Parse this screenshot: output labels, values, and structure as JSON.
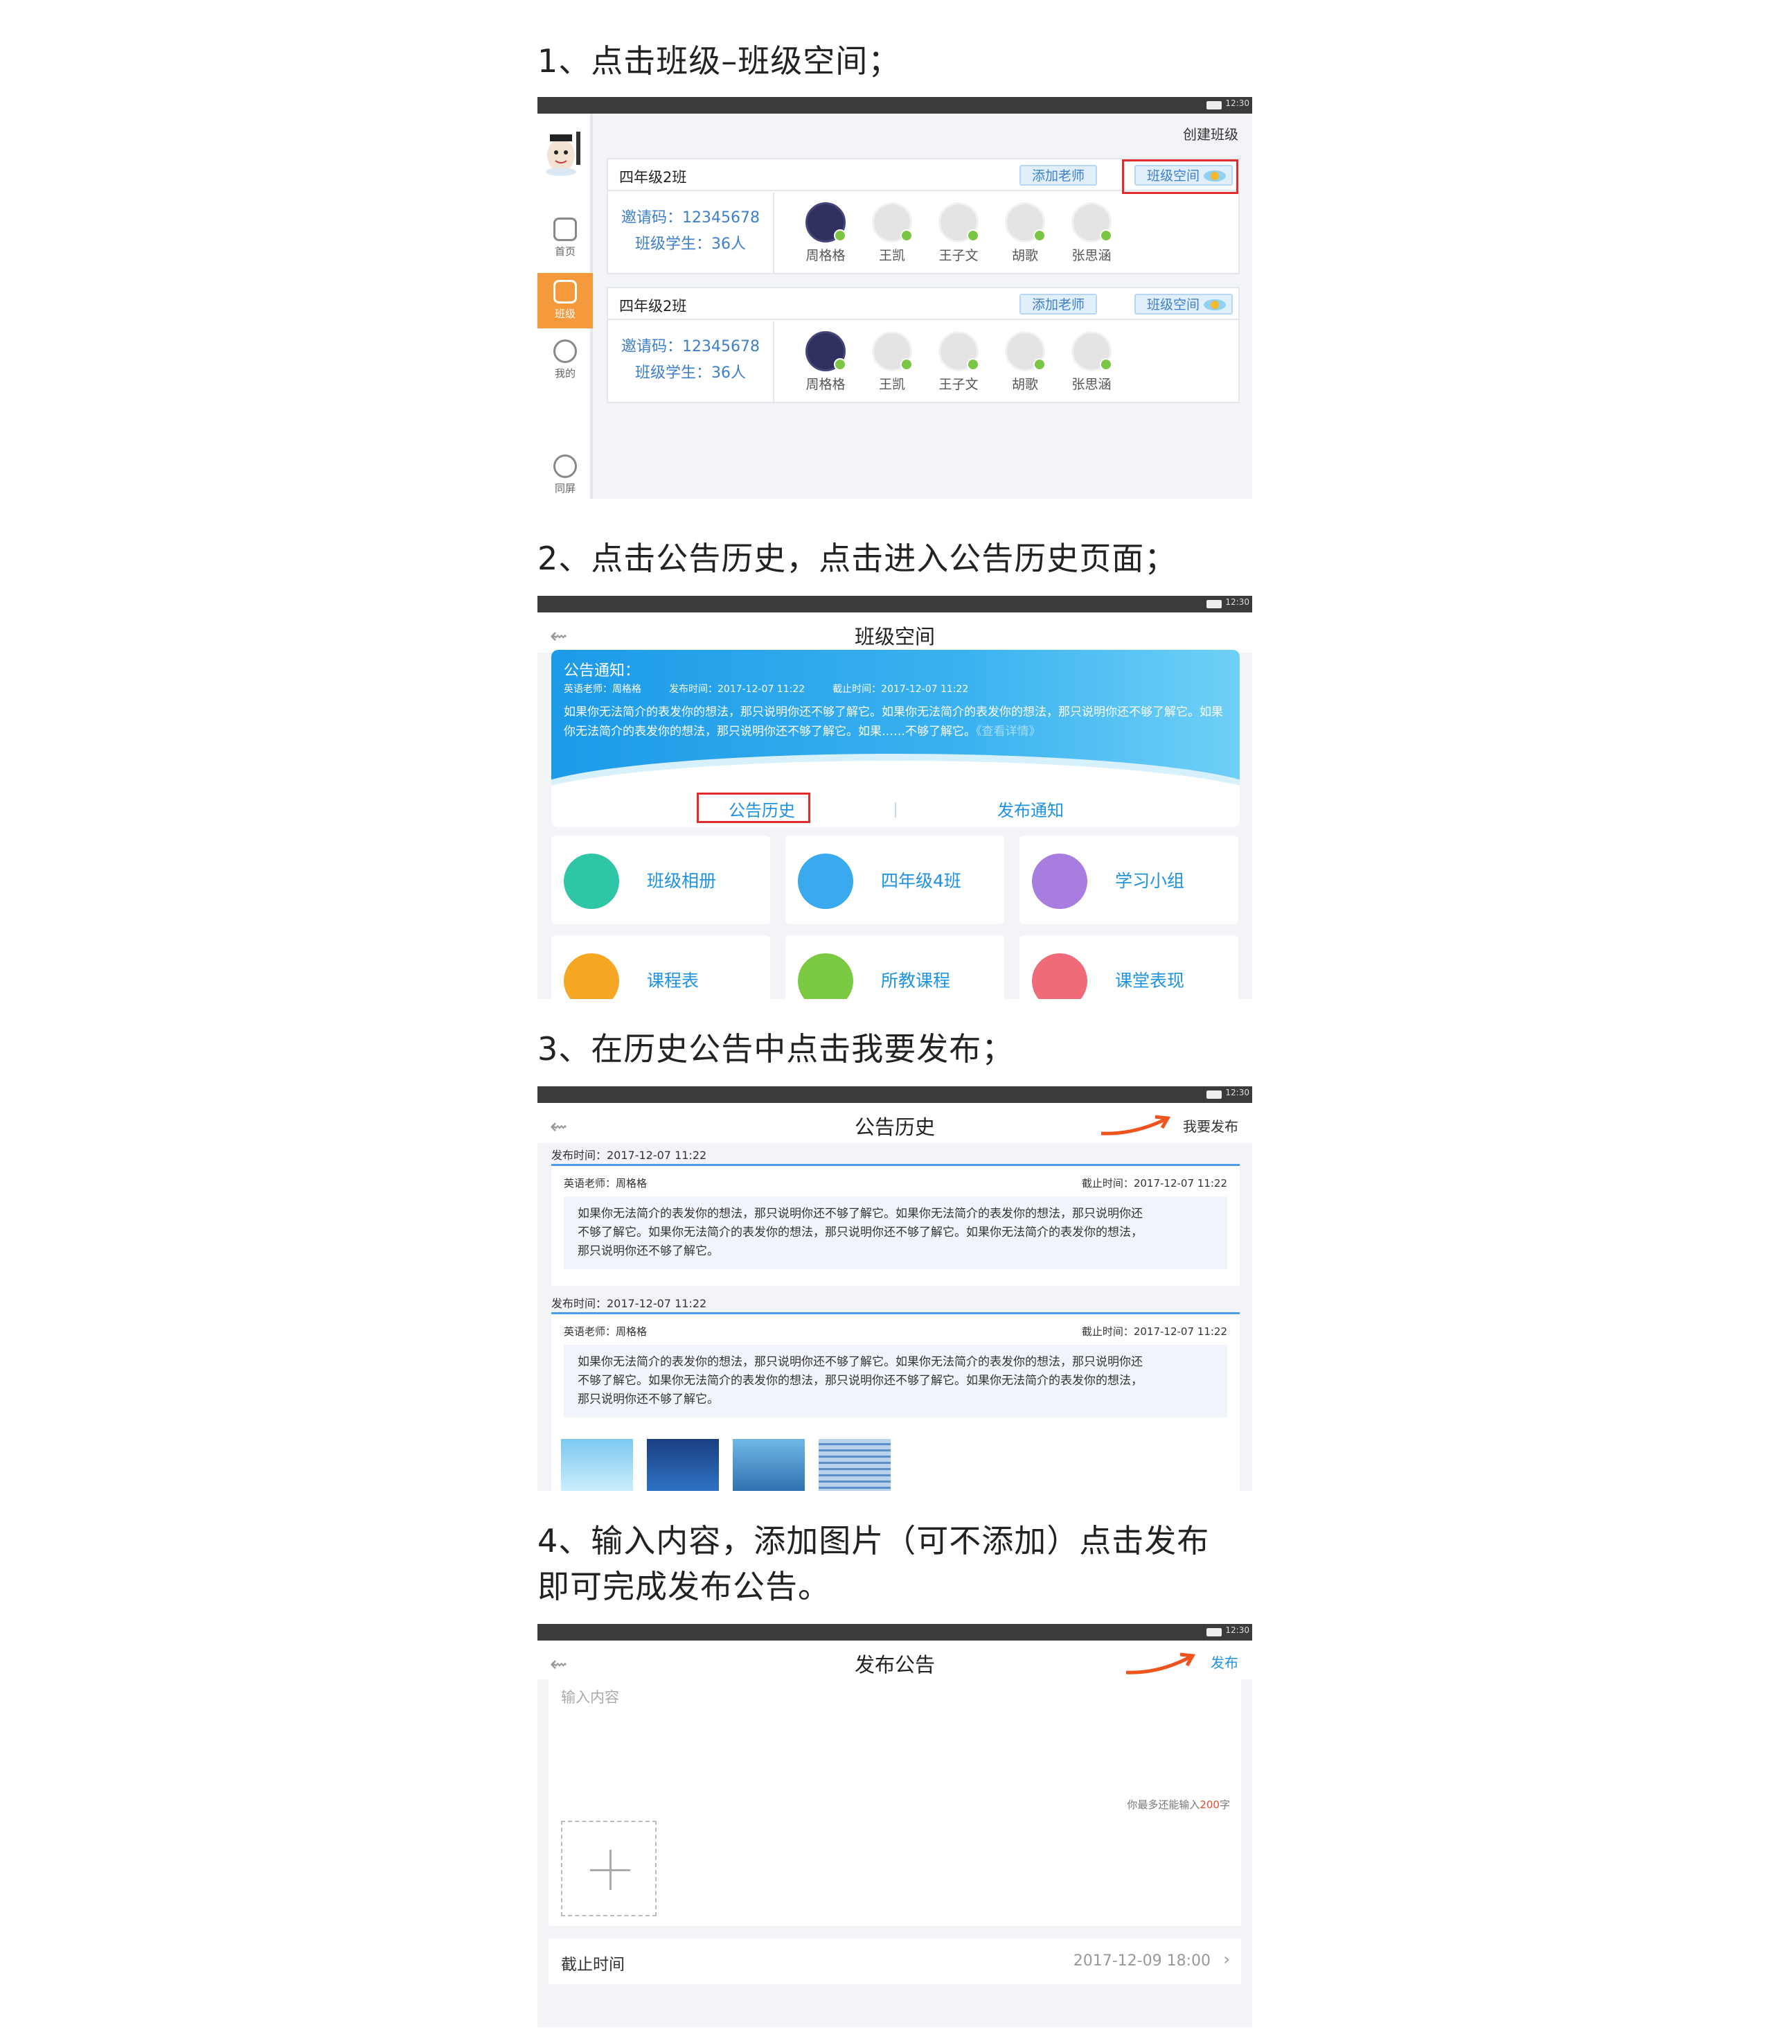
{
  "steps": [
    "1、点击班级–班级空间；",
    "2、点击公告历史，点击进入公告历史页面；",
    "3、在历史公告中点击我要发布；",
    "4、输入内容，添加图片（可不添加）点击发布",
    "即可完成发布公告。"
  ],
  "statusbar": {
    "time": "12:30"
  },
  "screen1": {
    "create_label": "创建班级",
    "nav": [
      {
        "label": "首页"
      },
      {
        "label": "班级"
      },
      {
        "label": "我的"
      },
      {
        "label": "同屏"
      }
    ],
    "classes": [
      {
        "name": "四年级2班",
        "add_teacher": "添加老师",
        "space": "班级空间",
        "invite": "邀请码：12345678",
        "students_count": "班级学生：36人",
        "students": [
          "周格格",
          "王凯",
          "王子文",
          "胡歌",
          "张思涵"
        ]
      },
      {
        "name": "四年级2班",
        "add_teacher": "添加老师",
        "space": "班级空间",
        "invite": "邀请码：12345678",
        "students_count": "班级学生：36人",
        "students": [
          "周格格",
          "王凯",
          "王子文",
          "胡歌",
          "张思涵"
        ]
      }
    ]
  },
  "screen2": {
    "title": "班级空间",
    "notice_title": "公告通知：",
    "teacher": "英语老师：周格格",
    "publish_time": "发布时间：2017-12-07 11:22",
    "deadline": "截止时间：2017-12-07 11:22",
    "body": "如果你无法简介的表发你的想法，那只说明你还不够了解它。如果你无法简介的表发你的想法，那只说明你还不够了解它。如果你无法简介的表发你的想法，那只说明你还不够了解它。如果……不够了解它。",
    "more": "《查看详情》",
    "tab_history": "公告历史",
    "tab_publish": "发布通知",
    "tiles": [
      {
        "label": "班级相册",
        "color": "#2ec6a6"
      },
      {
        "label": "四年级4班",
        "color": "#3aa9ee"
      },
      {
        "label": "学习小组",
        "color": "#a87de0"
      },
      {
        "label": "课程表",
        "color": "#f5a623"
      },
      {
        "label": "所教课程",
        "color": "#7ac943"
      },
      {
        "label": "课堂表现",
        "color": "#f06b7a"
      }
    ]
  },
  "screen3": {
    "title": "公告历史",
    "publish": "我要发布",
    "records": [
      {
        "time": "发布时间：2017-12-07 11:22",
        "teacher": "英语老师：周格格",
        "deadline": "截止时间：2017-12-07 11:22",
        "lines": [
          "如果你无法简介的表发你的想法，那只说明你还不够了解它。如果你无法简介的表发你的想法，那只说明你还",
          "不够了解它。如果你无法简介的表发你的想法，那只说明你还不够了解它。如果你无法简介的表发你的想法，",
          "那只说明你还不够了解它。"
        ]
      },
      {
        "time": "发布时间：2017-12-07 11:22",
        "teacher": "英语老师：周格格",
        "deadline": "截止时间：2017-12-07 11:22",
        "lines": [
          "如果你无法简介的表发你的想法，那只说明你还不够了解它。如果你无法简介的表发你的想法，那只说明你还",
          "不够了解它。如果你无法简介的表发你的想法，那只说明你还不够了解它。如果你无法简介的表发你的想法，",
          "那只说明你还不够了解它。"
        ]
      }
    ]
  },
  "screen4": {
    "title": "发布公告",
    "publish": "发布",
    "placeholder": "输入内容",
    "count_prefix": "你最多还能输入",
    "count_num": "200",
    "count_suffix": "字",
    "deadline_label": "截止时间",
    "deadline_value": "2017-12-09 18:00"
  }
}
